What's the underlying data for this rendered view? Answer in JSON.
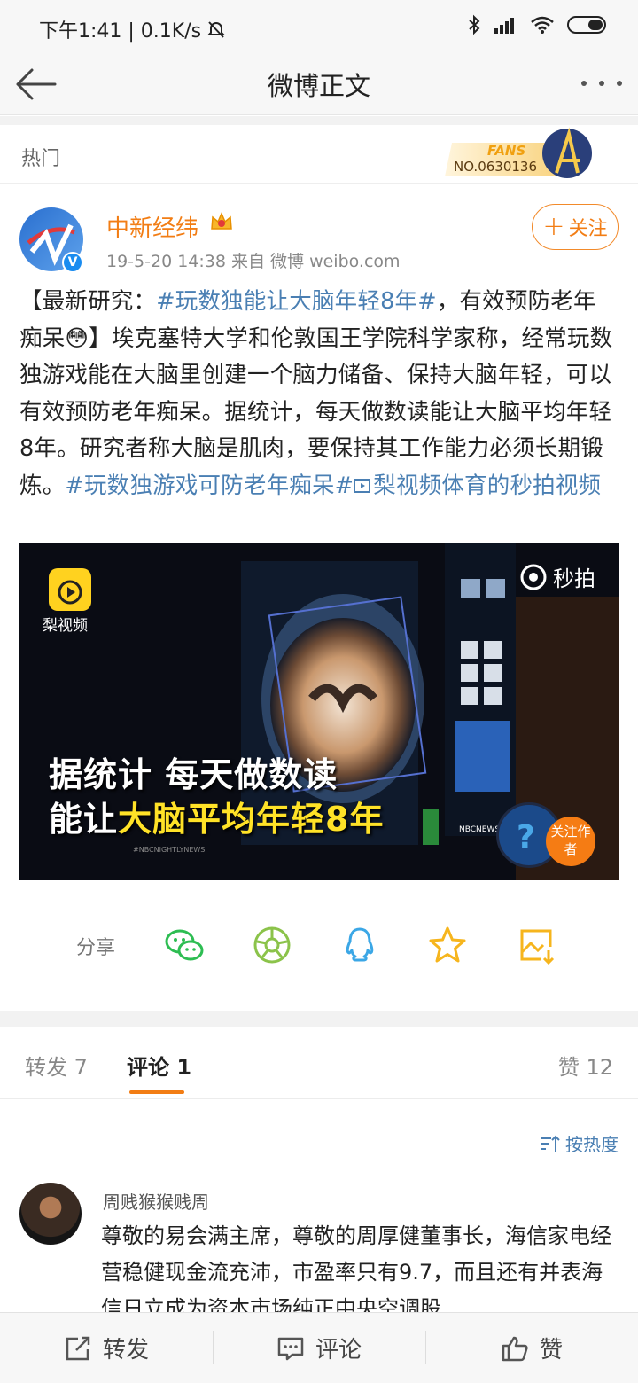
{
  "status_bar": {
    "time_speed": "下午1:41 | 0.1K/s"
  },
  "nav": {
    "title": "微博正文"
  },
  "hot": {
    "label": "热门",
    "fans_text": "FANS",
    "fans_no": "NO.0630136"
  },
  "post": {
    "author": "中新经纬",
    "meta": "19-5-20 14:38   来自 微博 weibo.com",
    "follow_label": "关注",
    "text_parts": {
      "p1": "【最新研究：",
      "tag1": "#玩数独能让大脑年轻8年#",
      "p2": "，有效预防老年痴呆😳】埃克塞特大学和伦敦国王学院科学家称，经常玩数独游戏能在大脑里创建一个脑力储备、保持大脑年轻，可以有效预防老年痴呆。据统计，每天做数读能让大脑平均年轻8年。研究者称大脑是肌肉，要保持其工作能力必须长期锻炼。",
      "tag2": "#玩数独游戏可防老年痴呆#",
      "tag3": "梨视频体育的秒拍视频"
    }
  },
  "video": {
    "app_name": "梨视频",
    "miaopai": "秒拍",
    "caption_line1": "据统计 每天做数读",
    "caption_line2_prefix": "能让",
    "caption_line2_highlight": "大脑平均年轻8年",
    "small_credit": "#NBCNIGHTLYNEWS",
    "nbc": "NBCNEWS.",
    "follow_author": "关注作者"
  },
  "share": {
    "label": "分享"
  },
  "tabs": {
    "repost": "转发 7",
    "comment": "评论 1",
    "likes": "赞 12"
  },
  "sort_label": "按热度",
  "comments": [
    {
      "name": "周贱猴猴贱周",
      "text": "尊敬的易会满主席，尊敬的周厚健董事长，海信家电经营稳健现金流充沛，市盈率只有9.7，而且还有并表海信日立成为资本市场纯正中央空调股"
    }
  ],
  "bottom_bar": {
    "repost": "转发",
    "comment": "评论",
    "like": "赞"
  },
  "colors": {
    "accent_orange": "#f27d14",
    "link_blue": "#4a7fb3"
  }
}
